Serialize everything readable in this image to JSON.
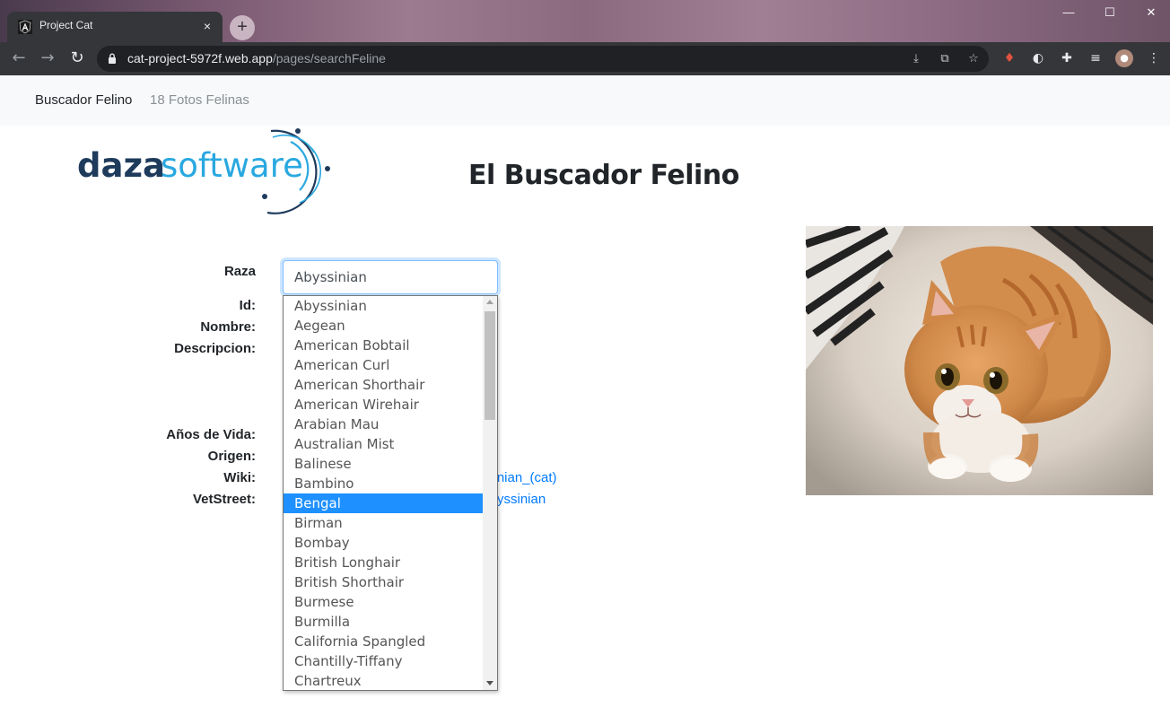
{
  "browser": {
    "tab_title": "Project Cat",
    "tab_close": "×",
    "new_tab": "+",
    "url_host": "cat-project-5972f.web.app",
    "url_path": "/pages/searchFeline",
    "minimize": "—",
    "maximize": "☐",
    "close": "✕"
  },
  "navbar": {
    "brand": "Buscador Felino",
    "link": "18 Fotos Felinas"
  },
  "logo": {
    "text_dark": "daza",
    "text_light": "software"
  },
  "page": {
    "title": "El Buscador Felino"
  },
  "form": {
    "labels": {
      "raza": "Raza",
      "id": "Id:",
      "nombre": "Nombre:",
      "descripcion": "Descripcion:",
      "anos": "Años de Vida:",
      "origen": "Origen:",
      "wiki": "Wiki:",
      "vetstreet": "VetStreet:"
    },
    "select_value": "Abyssinian",
    "wiki_link_visible": "sinian_(cat)",
    "vetstreet_link_visible": "yssinian"
  },
  "dropdown": {
    "options": [
      "Abyssinian",
      "Aegean",
      "American Bobtail",
      "American Curl",
      "American Shorthair",
      "American Wirehair",
      "Arabian Mau",
      "Australian Mist",
      "Balinese",
      "Bambino",
      "Bengal",
      "Birman",
      "Bombay",
      "British Longhair",
      "British Shorthair",
      "Burmese",
      "Burmilla",
      "California Spangled",
      "Chantilly-Tiffany",
      "Chartreux"
    ],
    "highlighted": "Bengal"
  },
  "colors": {
    "link": "#007bff",
    "highlight": "#1e90ff",
    "logo_dark": "#1f3b5c",
    "logo_light": "#29a8e0"
  }
}
